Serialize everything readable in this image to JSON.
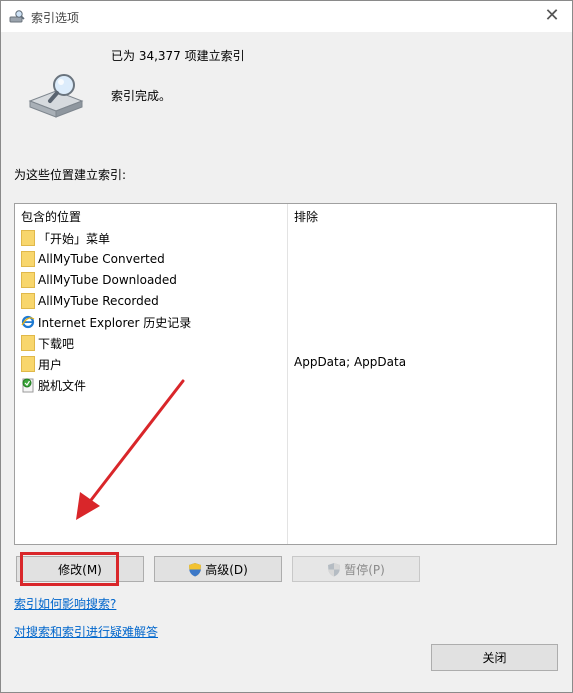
{
  "window": {
    "title": "索引选项",
    "close_glyph": "✕"
  },
  "status": {
    "count_text": "已为 34,377 项建立索引",
    "done_text": "索引完成。"
  },
  "locations_label": "为这些位置建立索引:",
  "list": {
    "headers": {
      "included": "包含的位置",
      "excluded": "排除"
    },
    "rows": [
      {
        "name": "「开始」菜单",
        "icon": "folder-icon",
        "excluded": ""
      },
      {
        "name": "AllMyTube Converted",
        "icon": "folder-icon",
        "excluded": ""
      },
      {
        "name": "AllMyTube Downloaded",
        "icon": "folder-icon",
        "excluded": ""
      },
      {
        "name": "AllMyTube Recorded",
        "icon": "folder-icon",
        "excluded": ""
      },
      {
        "name": "Internet Explorer 历史记录",
        "icon": "ie-icon",
        "excluded": ""
      },
      {
        "name": "下载吧",
        "icon": "folder-icon",
        "excluded": ""
      },
      {
        "name": "用户",
        "icon": "folder-icon",
        "excluded": "AppData; AppData"
      },
      {
        "name": "脱机文件",
        "icon": "offline-files-icon",
        "excluded": ""
      }
    ]
  },
  "buttons": {
    "modify": "修改(M)",
    "advanced": "高级(D)",
    "pause": "暂停(P)",
    "close": "关闭"
  },
  "links": {
    "how_indexing": "索引如何影响搜索?",
    "troubleshoot": "对搜索和索引进行疑难解答"
  },
  "colors": {
    "annotation_red": "#d9262a",
    "link_blue": "#0066cc"
  }
}
